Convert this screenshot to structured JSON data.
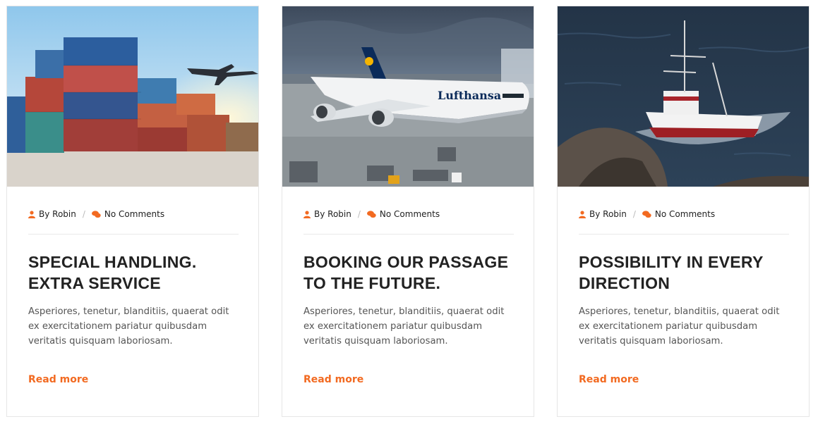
{
  "colors": {
    "accent": "#f26a21",
    "heading": "#222222",
    "text": "#555555"
  },
  "icons": {
    "author": "user-icon",
    "comments": "comments-icon"
  },
  "posts": [
    {
      "image_alt": "Shipping containers stacked at a port with a cargo plane taking off",
      "author": "By Robin",
      "comments": "No Comments",
      "title_line1": "SPECIAL HANDLING.",
      "title_line2": "EXTRA SERVICE",
      "excerpt": "Asperiores, tenetur, blanditiis, quaerat odit ex exercitationem pariatur quibusdam veritatis quisquam laboriosam.",
      "read_more": "Read more"
    },
    {
      "image_alt": "Lufthansa airliner parked at an airport apron",
      "author": "By Robin",
      "comments": "No Comments",
      "title_line1": "BOOKING OUR PASSAGE",
      "title_line2": "TO THE FUTURE.",
      "excerpt": "Asperiores, tenetur, blanditiis, quaerat odit ex exercitationem pariatur quibusdam veritatis quisquam laboriosam.",
      "read_more": "Read more"
    },
    {
      "image_alt": "Fishing boat sailing on dark sea water",
      "author": "By Robin",
      "comments": "No Comments",
      "title_line1": "POSSIBILITY IN EVERY",
      "title_line2": "DIRECTION",
      "excerpt": "Asperiores, tenetur, blanditiis, quaerat odit ex exercitationem pariatur quibusdam veritatis quisquam laboriosam.",
      "read_more": "Read more"
    }
  ]
}
